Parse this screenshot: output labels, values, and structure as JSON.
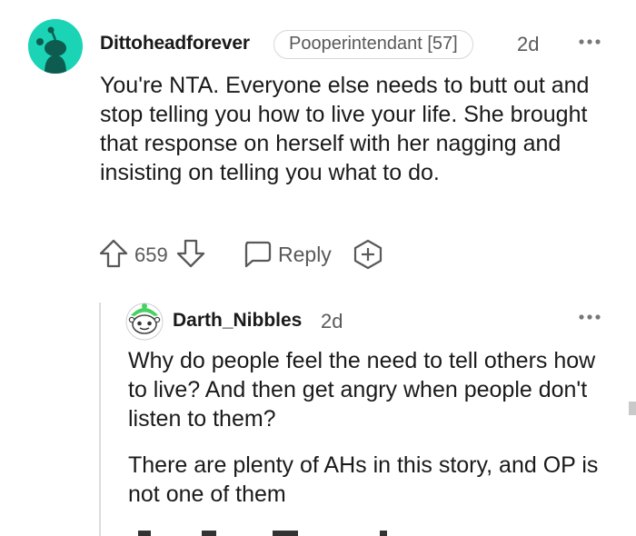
{
  "comment": {
    "username": "Dittoheadforever",
    "flair": "Pooperintendant [57]",
    "time": "2d",
    "more_icon": "more-dots-icon",
    "body": "You're NTA. Everyone else needs to butt out and stop telling you how to live your life. She brought that response on herself with her nagging and insisting on telling you what to do.",
    "score": "659",
    "reply_label": "Reply",
    "avatar_color": "#1bd4b6"
  },
  "reply": {
    "username": "Darth_Nibbles",
    "time": "2d",
    "more_icon": "more-dots-icon",
    "paragraphs": [
      "Why do people feel the need to tell others how to live? And then get angry when people don't listen to them?",
      "There are plenty of AHs in this story, and OP is not one of them"
    ],
    "avatar_accent": "#46d160"
  },
  "colors": {
    "text": "#1a1a1b",
    "meta": "#595959",
    "border": "#d7d7d7"
  }
}
